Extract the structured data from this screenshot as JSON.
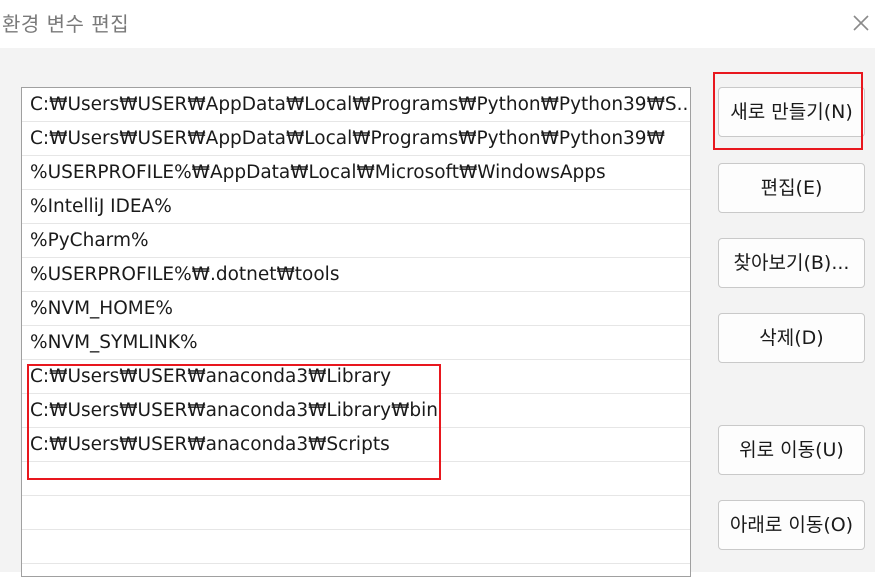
{
  "window": {
    "title": "환경 변수 편집",
    "close_icon": "close-icon"
  },
  "path_list": {
    "items": [
      "C:₩Users₩USER₩AppData₩Local₩Programs₩Python₩Python39₩S...",
      "C:₩Users₩USER₩AppData₩Local₩Programs₩Python₩Python39₩",
      "%USERPROFILE%₩AppData₩Local₩Microsoft₩WindowsApps",
      "%IntelliJ IDEA%",
      "%PyCharm%",
      "%USERPROFILE%₩.dotnet₩tools",
      "%NVM_HOME%",
      "%NVM_SYMLINK%",
      "C:₩Users₩USER₩anaconda3₩Library",
      "C:₩Users₩USER₩anaconda3₩Library₩bin",
      "C:₩Users₩USER₩anaconda3₩Scripts",
      "",
      "",
      ""
    ]
  },
  "buttons": {
    "new": "새로 만들기(N)",
    "edit": "편집(E)",
    "browse": "찾아보기(B)...",
    "delete": "삭제(D)",
    "move_up": "위로 이동(U)",
    "move_down": "아래로 이동(O)"
  },
  "colors": {
    "highlight": "#e8171e",
    "background": "#f3f3f3"
  }
}
